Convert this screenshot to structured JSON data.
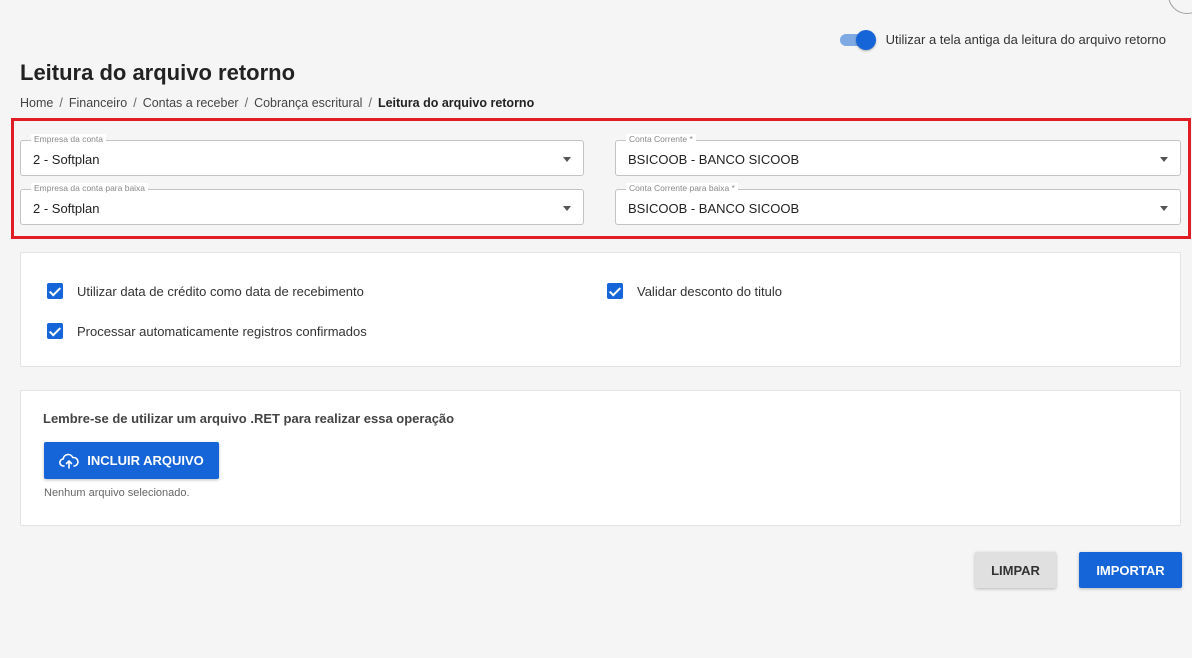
{
  "header": {
    "toggle_label": "Utilizar a tela antiga da leitura do arquivo retorno",
    "toggle_on": true,
    "title": "Leitura do arquivo retorno"
  },
  "breadcrumb": {
    "items": [
      "Home",
      "Financeiro",
      "Contas a receber",
      "Cobrança escritural"
    ],
    "current": "Leitura do arquivo retorno",
    "separator": "/"
  },
  "filters": {
    "empresa_conta": {
      "label": "Empresa da conta",
      "value": "2 -  Softplan"
    },
    "conta_corrente": {
      "label": "Conta Corrente *",
      "value": "BSICOOB - BANCO SICOOB"
    },
    "empresa_baixa": {
      "label": "Empresa da conta para baixa",
      "value": "2 -  Softplan"
    },
    "conta_baixa": {
      "label": "Conta Corrente para baixa *",
      "value": "BSICOOB - BANCO SICOOB"
    }
  },
  "options": {
    "data_credito": {
      "label": "Utilizar data de crédito como data de recebimento",
      "checked": true
    },
    "validar_desconto": {
      "label": "Validar desconto do titulo",
      "checked": true
    },
    "processar_auto": {
      "label": "Processar automaticamente registros confirmados",
      "checked": true
    }
  },
  "upload": {
    "hint": "Lembre-se de utilizar um arquivo .RET para realizar essa operação",
    "button_label": "INCLUIR ARQUIVO",
    "button_icon": "cloud-upload-icon",
    "status": "Nenhum arquivo selecionado."
  },
  "actions": {
    "clear_label": "LIMPAR",
    "import_label": "IMPORTAR"
  },
  "colors": {
    "primary": "#1565d8",
    "highlight": "#e01c24"
  }
}
